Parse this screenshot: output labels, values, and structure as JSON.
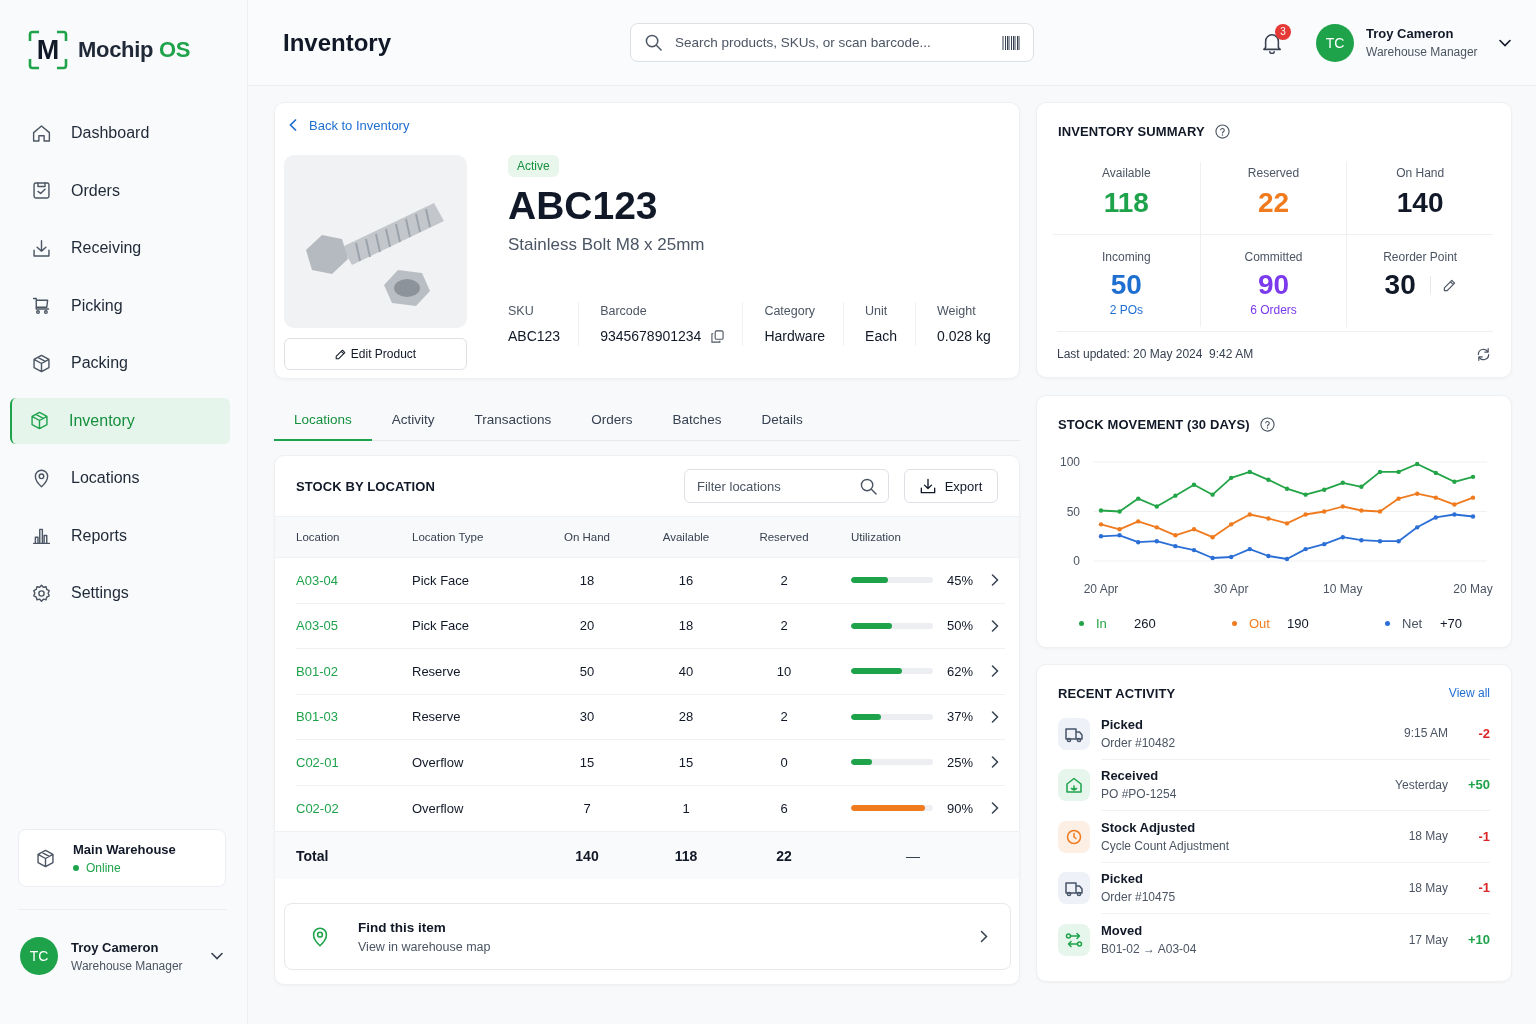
{
  "sidebar": {
    "brand": {
      "mark": "M",
      "name": "Mochip",
      "suffix": "OS"
    },
    "nav": [
      {
        "label": "Dashboard",
        "selected": false
      },
      {
        "label": "Orders",
        "selected": false
      },
      {
        "label": "Receiving",
        "selected": false
      },
      {
        "label": "Picking",
        "selected": false
      },
      {
        "label": "Packing",
        "selected": false
      },
      {
        "label": "Inventory",
        "selected": true
      },
      {
        "label": "Locations",
        "selected": false
      },
      {
        "label": "Reports",
        "selected": false
      },
      {
        "label": "Settings",
        "selected": false
      }
    ],
    "warehouse": {
      "name": "Main Warehouse",
      "status": "Online",
      "online": true
    },
    "user": {
      "initials": "TC",
      "name": "Troy Cameron",
      "role": "Warehouse Manager"
    }
  },
  "header": {
    "title": "Inventory",
    "search": {
      "placeholder": "Search products, SKUs, or scan barcode..."
    },
    "notifications": "3",
    "user": {
      "initials": "TC",
      "name": "Troy Cameron",
      "role": "Warehouse Manager"
    }
  },
  "product": {
    "back_link": "Back to Inventory",
    "status": "Active",
    "code": "ABC123",
    "name": "Stainless Bolt M8 x 25mm",
    "edit_button": "Edit Product",
    "fields": [
      {
        "label": "SKU",
        "value": "ABC123",
        "copyable": false
      },
      {
        "label": "Barcode",
        "value": "9345678901234",
        "copyable": true
      },
      {
        "label": "Category",
        "value": "Hardware",
        "copyable": false
      },
      {
        "label": "Unit",
        "value": "Each",
        "copyable": false
      },
      {
        "label": "Weight",
        "value": "0.028 kg",
        "copyable": false
      }
    ]
  },
  "tabs": [
    {
      "label": "Locations",
      "selected": true
    },
    {
      "label": "Activity",
      "selected": false
    },
    {
      "label": "Transactions",
      "selected": false
    },
    {
      "label": "Orders",
      "selected": false
    },
    {
      "label": "Batches",
      "selected": false
    },
    {
      "label": "Details",
      "selected": false
    }
  ],
  "stock": {
    "title": "STOCK BY LOCATION",
    "filter": {
      "placeholder": "Filter locations"
    },
    "export_button": "Export",
    "columns": [
      "Location",
      "Location Type",
      "On Hand",
      "Available",
      "Reserved",
      "Utilization"
    ],
    "rows": [
      {
        "location": "A03-04",
        "type": "Pick Face",
        "on_hand": "18",
        "available": "16",
        "reserved": "2",
        "level": 0.45,
        "utilization": "45%",
        "color": "#1ea34b"
      },
      {
        "location": "A03-05",
        "type": "Pick Face",
        "on_hand": "20",
        "available": "18",
        "reserved": "2",
        "level": 0.5,
        "utilization": "50%",
        "color": "#1ea34b"
      },
      {
        "location": "B01-02",
        "type": "Reserve",
        "on_hand": "50",
        "available": "40",
        "reserved": "10",
        "level": 0.62,
        "utilization": "62%",
        "color": "#1ea34b"
      },
      {
        "location": "B01-03",
        "type": "Reserve",
        "on_hand": "30",
        "available": "28",
        "reserved": "2",
        "level": 0.37,
        "utilization": "37%",
        "color": "#1ea34b"
      },
      {
        "location": "C02-01",
        "type": "Overflow",
        "on_hand": "15",
        "available": "15",
        "reserved": "0",
        "level": 0.25,
        "utilization": "25%",
        "color": "#1ea34b"
      },
      {
        "location": "C02-02",
        "type": "Overflow",
        "on_hand": "7",
        "available": "1",
        "reserved": "6",
        "level": 0.9,
        "utilization": "90%",
        "color": "#f07b1f"
      }
    ],
    "total": {
      "label": "Total",
      "on_hand": "140",
      "available": "118",
      "reserved": "22",
      "utilization": "—"
    }
  },
  "find_item": {
    "title": "Find this item",
    "subtitle": "View in warehouse map"
  },
  "summary": {
    "title": "INVENTORY SUMMARY",
    "stats": [
      {
        "label": "Available",
        "value": "118",
        "color": "#1ea34b",
        "editable": false
      },
      {
        "label": "Reserved",
        "value": "22",
        "color": "#f07b1f",
        "editable": false
      },
      {
        "label": "On Hand",
        "value": "140",
        "color": "#111827",
        "editable": false
      },
      {
        "label": "Incoming",
        "value": "50",
        "sub": "2 POs",
        "color": "#1f6fd1",
        "editable": false
      },
      {
        "label": "Committed",
        "value": "90",
        "sub": "6 Orders",
        "color": "#7c3aed",
        "editable": false
      },
      {
        "label": "Reorder Point",
        "value": "30",
        "color": "#111827",
        "editable": true
      }
    ],
    "updated": "Last updated: 20 May 2024  9:42 AM"
  },
  "movement": {
    "chart_data": {
      "type": "line",
      "title": "STOCK MOVEMENT (30 DAYS)",
      "categories": [
        "20 Apr",
        null,
        null,
        null,
        null,
        null,
        null,
        "30 Apr",
        null,
        null,
        null,
        null,
        null,
        "10 May",
        null,
        null,
        null,
        null,
        null,
        null,
        "20 May"
      ],
      "ylim": [
        0,
        100
      ],
      "yticks": [
        0,
        50,
        100
      ],
      "series": [
        {
          "name": "In",
          "color": "#22a447",
          "values": [
            51,
            50,
            63,
            55,
            66,
            77,
            67,
            84,
            90,
            82,
            73,
            67,
            72,
            79,
            75,
            90,
            90,
            98,
            89,
            80,
            85
          ]
        },
        {
          "name": "Out",
          "color": "#f07b1f",
          "values": [
            37,
            32,
            40,
            34,
            26,
            32,
            24,
            37,
            47,
            43,
            38,
            47,
            50,
            55,
            51,
            50,
            63,
            68,
            64,
            57,
            64
          ]
        },
        {
          "name": "Net",
          "color": "#2b6fd6",
          "values": [
            25,
            26,
            19,
            20,
            15,
            11,
            3,
            4,
            12,
            5,
            2,
            12,
            17,
            24,
            21,
            20,
            20,
            34,
            44,
            47,
            45
          ]
        }
      ]
    },
    "legend": [
      {
        "total": "260",
        "tinted": true
      },
      {
        "total": "190",
        "tinted": true
      },
      {
        "total": "+70",
        "tinted": false
      }
    ]
  },
  "activity": {
    "title": "RECENT ACTIVITY",
    "view_all": "View all",
    "items": [
      {
        "kind": "picked",
        "title": "Picked",
        "detail": "Order #10482",
        "time": "9:15 AM",
        "change": "-2",
        "color": "#dc2626"
      },
      {
        "kind": "received",
        "title": "Received",
        "detail": "PO #PO-1254",
        "time": "Yesterday",
        "change": "+50",
        "color": "#1ea34b"
      },
      {
        "kind": "adjusted",
        "title": "Stock Adjusted",
        "detail": "Cycle Count Adjustment",
        "time": "18 May",
        "change": "-1",
        "color": "#dc2626"
      },
      {
        "kind": "picked",
        "title": "Picked",
        "detail": "Order #10475",
        "time": "18 May",
        "change": "-1",
        "color": "#dc2626"
      },
      {
        "kind": "moved",
        "title": "Moved",
        "detail": "B01-02 → A03-04",
        "time": "17 May",
        "change": "+10",
        "color": "#1ea34b"
      }
    ]
  }
}
